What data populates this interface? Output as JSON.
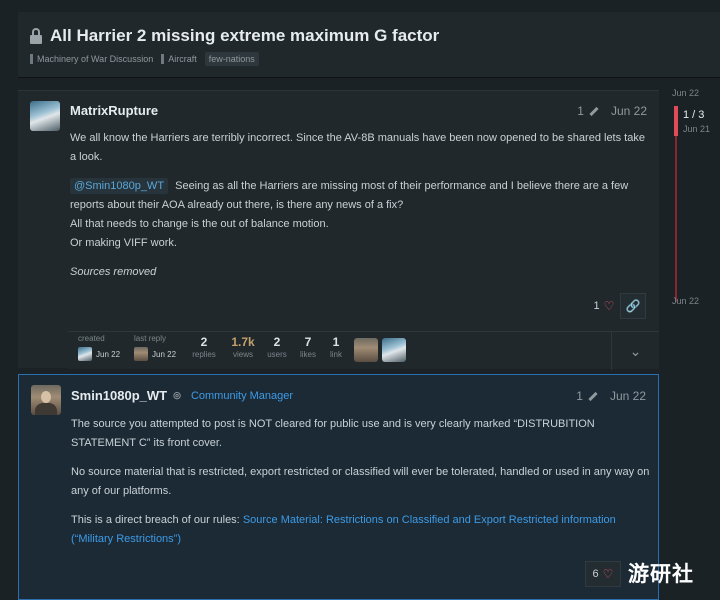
{
  "topic": {
    "title": "All Harrier 2 missing extreme maximum G factor",
    "category": "Machinery of War Discussion",
    "subcategory": "Aircraft",
    "tag": "few-nations"
  },
  "post1": {
    "username": "MatrixRupture",
    "edit_count": "1",
    "date": "Jun 22",
    "paragraph1": "We all know the Harriers are terribly incorrect. Since the AV-8B manuals have been now opened to be shared lets take a look.",
    "mention": "@Smin1080p_WT",
    "paragraph2_rest": "Seeing as all the Harriers are missing most of their performance and I believe there are a few reports about their AOA already out there, is there any news of a fix?",
    "line3": "All that needs to change is the out of balance motion.",
    "line4": "Or making VIFF work.",
    "sources": "Sources removed",
    "likes": "1"
  },
  "stats": {
    "created_label": "created",
    "created_date": "Jun 22",
    "last_reply_label": "last reply",
    "last_reply_date": "Jun 22",
    "replies": "2",
    "replies_label": "replies",
    "views": "1.7k",
    "views_label": "views",
    "users": "2",
    "users_label": "users",
    "likes": "7",
    "likes_label": "likes",
    "links": "1",
    "links_label": "link"
  },
  "post2": {
    "username": "Smin1080p_WT",
    "user_title": "Community Manager",
    "edit_count": "1",
    "date": "Jun 22",
    "paragraph1": "The source you attempted to post is NOT cleared for public use and is very clearly marked “DISTRUBITION STATEMENT C” its front cover.",
    "paragraph2": "No source material that is restricted, export restricted or classified will ever be tolerated, handled or used in any way on any of our platforms.",
    "paragraph3_prefix": "This is a direct breach of our rules:",
    "paragraph3_link": "Source Material: Restrictions on Classified and Export Restricted information (“Military Restrictions”)",
    "likes": "6"
  },
  "timeline": {
    "top_date": "Jun 22",
    "position": "1 / 3",
    "position_date": "Jun 21",
    "bottom_date": "Jun 22"
  },
  "watermark": "游研社",
  "colors": {
    "accent": "#3d9be6",
    "timeline": "#e14a56",
    "heart": "#e0546a"
  },
  "icons": [
    "lock-icon",
    "pencil-icon",
    "heart-icon",
    "link-icon",
    "chevron-down-icon",
    "shield-icon"
  ]
}
